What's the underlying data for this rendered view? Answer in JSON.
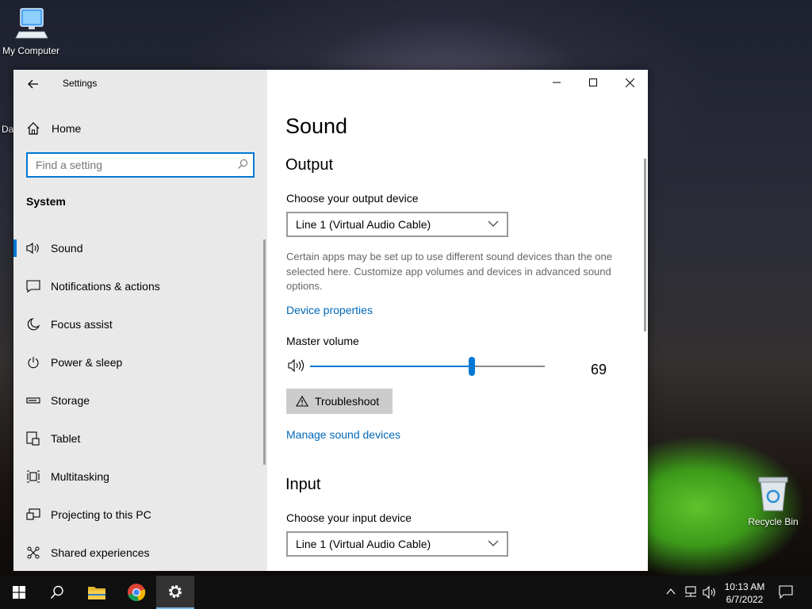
{
  "desktop": {
    "my_computer_label": "My Computer",
    "partial_label": "Da",
    "recycle_bin_label": "Recycle Bin"
  },
  "window": {
    "title": "Settings",
    "home_label": "Home",
    "search_placeholder": "Find a setting",
    "category_label": "System",
    "nav_items": [
      {
        "label": "Sound",
        "icon": "speaker-icon",
        "active": true
      },
      {
        "label": "Notifications & actions",
        "icon": "message-icon"
      },
      {
        "label": "Focus assist",
        "icon": "moon-icon"
      },
      {
        "label": "Power & sleep",
        "icon": "power-icon"
      },
      {
        "label": "Storage",
        "icon": "storage-icon"
      },
      {
        "label": "Tablet",
        "icon": "tablet-icon"
      },
      {
        "label": "Multitasking",
        "icon": "multitasking-icon"
      },
      {
        "label": "Projecting to this PC",
        "icon": "projecting-icon"
      },
      {
        "label": "Shared experiences",
        "icon": "shared-icon"
      }
    ]
  },
  "main": {
    "page_title": "Sound",
    "output_heading": "Output",
    "output_device_label": "Choose your output device",
    "output_device_value": "Line 1 (Virtual Audio Cable)",
    "output_description": "Certain apps may be set up to use different sound devices than the one selected here. Customize app volumes and devices in advanced sound options.",
    "device_properties_link": "Device properties",
    "master_volume_label": "Master volume",
    "volume_value": "69",
    "volume_level": 0.69,
    "troubleshoot_label": "Troubleshoot",
    "manage_devices_link": "Manage sound devices",
    "input_heading": "Input",
    "input_device_label": "Choose your input device",
    "input_device_value": "Line 1 (Virtual Audio Cable)"
  },
  "taskbar": {
    "time": "10:13 AM",
    "date": "6/7/2022"
  },
  "colors": {
    "accent": "#0078d4",
    "link": "#0067b8",
    "sidebar_bg": "#e9e9e9"
  }
}
